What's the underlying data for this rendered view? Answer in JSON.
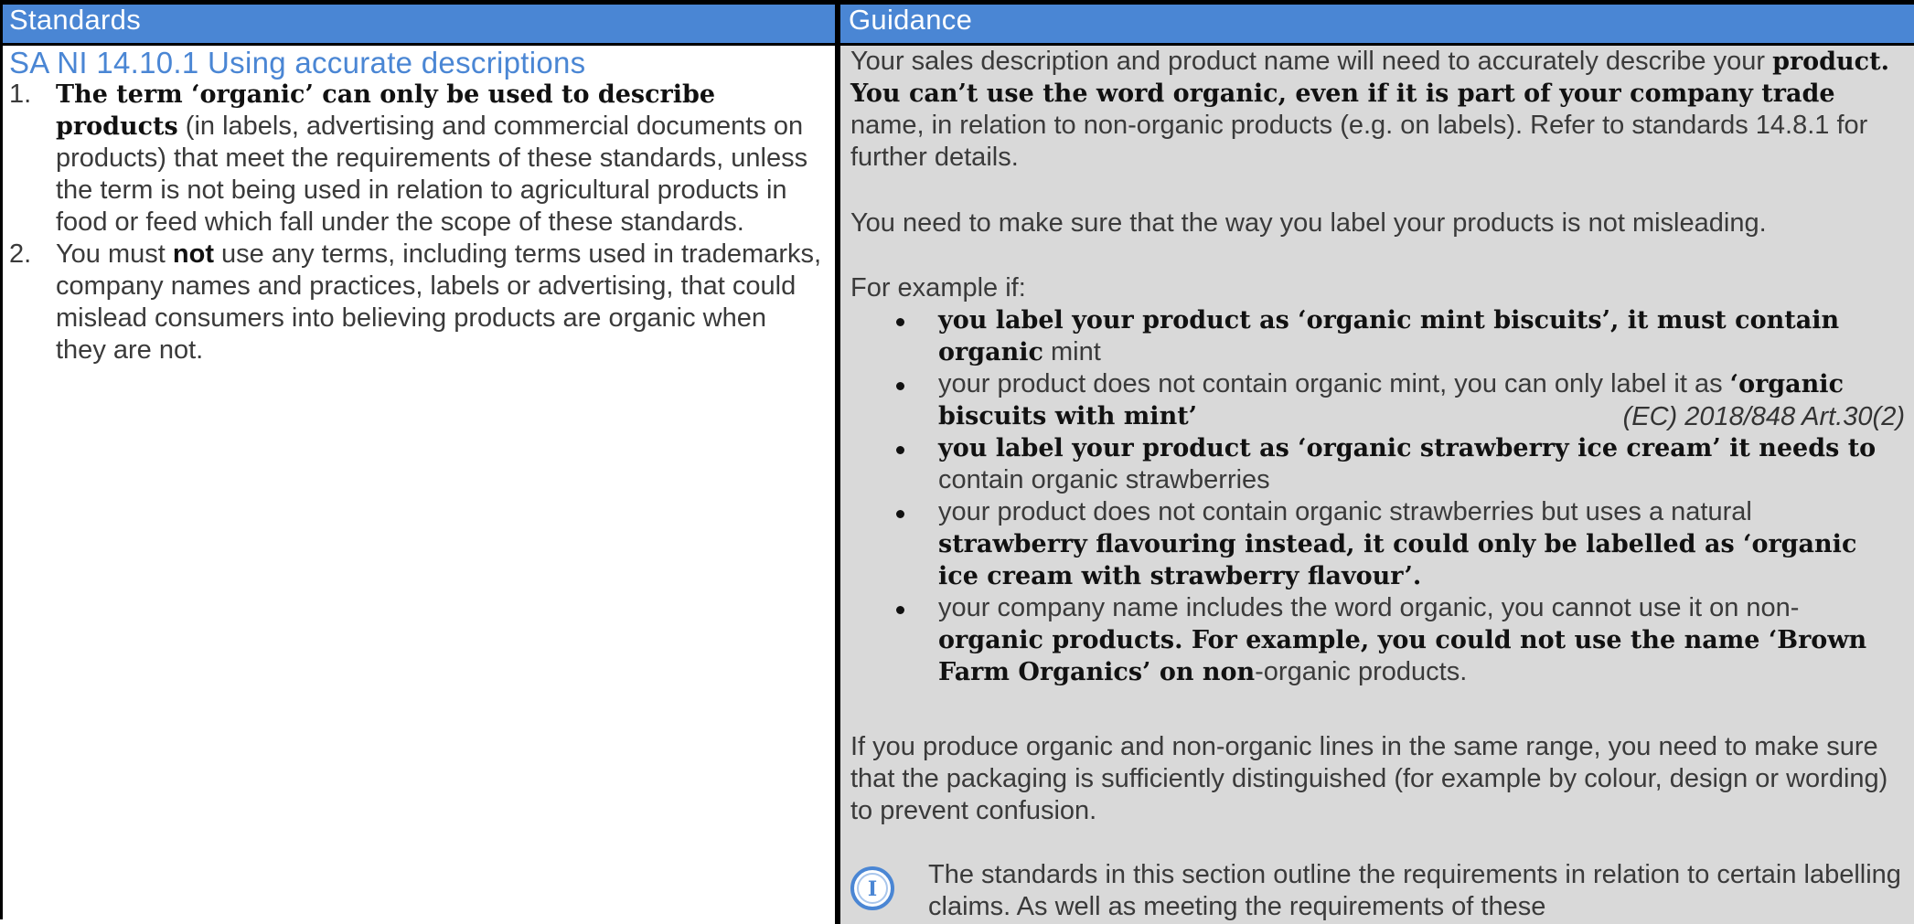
{
  "header": {
    "left": "Standards",
    "right": "Guidance"
  },
  "standards": {
    "title": "SA NI 14.10.1 Using accurate descriptions",
    "items": [
      {
        "num": "1.",
        "bold": "The term ‘organic’ can only be used to describe products",
        "rest": " (in labels, advertising and commercial documents on products) that meet the requirements of these standards, unless the term is not being used in relation to agricultural products in food or feed which fall under the scope of these standards."
      },
      {
        "num": "2.",
        "pre": "You must ",
        "bold": "not",
        "rest": " use any terms, including terms used in trademarks, company names and practices, labels or advertising, that could mislead consumers into believing products are organic when they are not."
      }
    ],
    "reference": "(EC) 2018/848 Art.30(2)"
  },
  "guidance": {
    "p1": {
      "a": "Your sales description and product name will need to accurately describe your ",
      "b": "product. You can’t use the word organic, even if it is part of your company trade",
      "c": " name, in relation to non-organic products (e.g. on labels). Refer to standards 14.8.1 for further details."
    },
    "p2": "You need to make sure that the way you label your products is not misleading.",
    "p3": "For example if:",
    "bullets": [
      {
        "a": "",
        "b": "you label your product as ‘organic mint biscuits’, it must contain organic",
        "c": " mint"
      },
      {
        "a": "your product does not contain organic mint, you can only label it as ",
        "b": "‘organic biscuits with mint’",
        "c": ""
      },
      {
        "a": "",
        "b": "you label your product as ‘organic strawberry ice cream’ it needs to",
        "c": " contain organic strawberries"
      },
      {
        "a": "your product does not contain organic strawberries but uses a natural ",
        "b": "strawberry flavouring instead, it could only be labelled as ‘organic ice cream with strawberry flavour’.",
        "c": ""
      },
      {
        "a": "your company name includes the word organic, you cannot use it on non-",
        "b": "organic products. For example, you could not use the name ‘Brown Farm Organics’ on non",
        "c": "-organic products."
      }
    ],
    "p4": "If you produce organic and non-organic lines in the same range, you need to make sure that the packaging is sufficiently distinguished (for example by colour, design or wording) to prevent confusion.",
    "p5": "The standards in this section outline the requirements in relation to certain labelling claims. As well as meeting the requirements of these",
    "info_icon": "info-icon",
    "colors": {
      "header": "#4a86d4",
      "guidance_bg": "#d9d9d9",
      "title": "#4a86d4"
    }
  }
}
